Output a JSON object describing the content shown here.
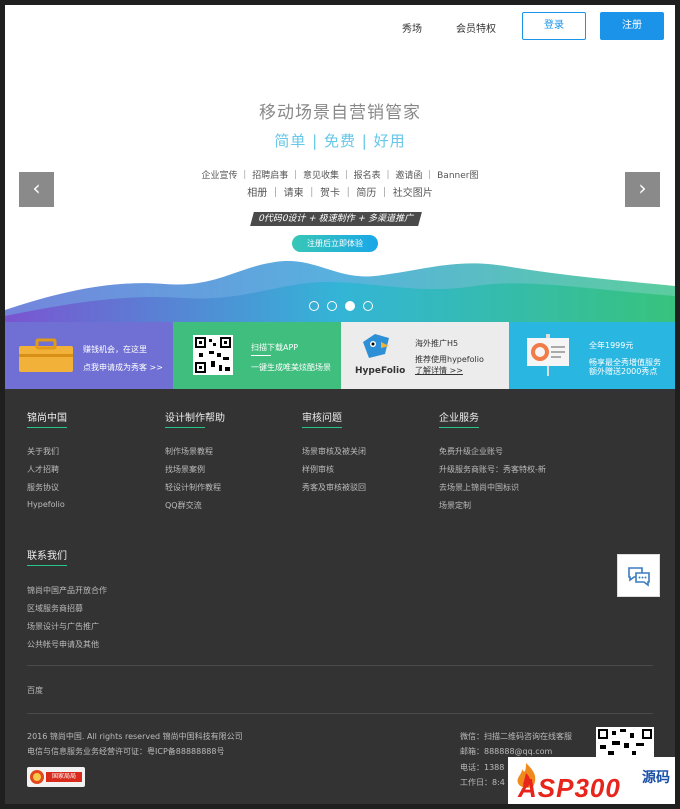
{
  "nav": {
    "xiuchang": "秀场",
    "member": "会员特权",
    "login": "登录",
    "register": "注册"
  },
  "hero": {
    "title": "移动场景自营销管家",
    "subtitle": "简单 | 免费 | 好用",
    "tags_line1": "企业宣传 ｜ 招聘启事 ｜ 意见收集 ｜ 报名表 ｜ 邀请函 ｜ Banner图",
    "tags_line2": "相册 ｜ 请柬 ｜ 贺卡 ｜ 简历 ｜ 社交图片",
    "slogan": "0代码0设计 + 极速制作 + 多渠道推广",
    "cta": "注册后立即体验",
    "prev": "‹",
    "next": "›",
    "active_dot": 2
  },
  "promos": [
    {
      "line1": "赚钱机会，在这里",
      "line2": "点我申请成为秀客 >>",
      "color": "#6f6fd4"
    },
    {
      "line1": "扫描下载APP",
      "line2": "一键生成唯美炫酷场景",
      "color": "#3fbe7e"
    },
    {
      "brand": "HypeFolio",
      "line1": "海外推广H5",
      "line2": "推荐使用hypefolio",
      "line3": "了解详情 >>",
      "color": "#ececec"
    },
    {
      "line1": "全年1999元",
      "line2": "畅享最全秀增值服务",
      "line3": "额外赠送2000秀点",
      "color": "#29b6e0"
    }
  ],
  "footer": {
    "columns": [
      {
        "title": "锦尚中国",
        "links": [
          "关于我们",
          "人才招聘",
          "服务协议",
          "Hypefolio"
        ]
      },
      {
        "title": "设计制作帮助",
        "links": [
          "制作场景教程",
          "找场景案例",
          "轻设计制作教程",
          "QQ群交流"
        ]
      },
      {
        "title": "审核问题",
        "links": [
          "场景审核及被关闭",
          "样例审核",
          "秀客及审核被驳回"
        ]
      },
      {
        "title": "企业服务",
        "links": [
          "免费升级企业账号",
          "升级服务商账号：秀客特权-新",
          "去场景上锦尚中国标识",
          "场景定制"
        ]
      }
    ],
    "contact": {
      "title": "联系我们",
      "links": [
        "锦尚中国产品开放合作",
        "区域服务商招募",
        "场景设计与广告推广",
        "公共帐号申请及其他"
      ]
    },
    "friend_link": "百度",
    "copyright": "2016 锦尚中国. All rights reserved 锦尚中国科技有限公司",
    "icp": "电信与信息服务业务经营许可证：粤ICP备88888888号",
    "wechat": "微信：扫描二维码咨询在线客服",
    "email": "邮箱：888888@qq.com",
    "phone": "电话：1388",
    "hours": "工作日：8:4",
    "badge": "国家局局",
    "watermark": "ASP300",
    "watermark_sub": "源码"
  }
}
